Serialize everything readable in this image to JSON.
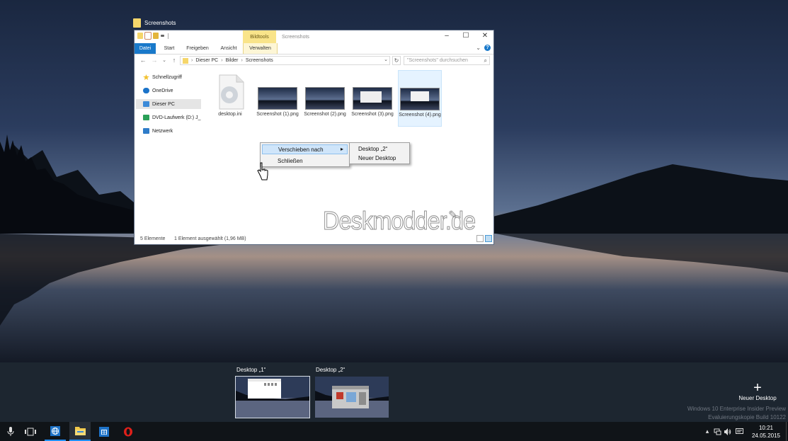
{
  "task_view": {
    "window_label": "Screenshots",
    "desktops": [
      {
        "label": "Desktop „1“",
        "active": true
      },
      {
        "label": "Desktop „2“",
        "active": false
      }
    ],
    "new_desktop_label": "Neuer Desktop",
    "os_watermark_line1": "Windows 10 Enterprise Insider Preview",
    "os_watermark_line2": "Evaluierungskopie Build 10122"
  },
  "explorer": {
    "title": "Screenshots",
    "bildtools_label": "Bildtools",
    "ribbon_tabs": [
      "Datei",
      "Start",
      "Freigeben",
      "Ansicht",
      "Verwalten"
    ],
    "address": {
      "path": [
        "Dieser PC",
        "Bilder",
        "Screenshots"
      ]
    },
    "search_placeholder": "\"Screenshots\" durchsuchen",
    "nav_items": [
      {
        "label": "Schnellzugriff",
        "icon": "star-icon",
        "color": "#f2c230"
      },
      {
        "label": "OneDrive",
        "icon": "cloud-icon",
        "color": "#1b73c9"
      },
      {
        "label": "Dieser PC",
        "icon": "computer-icon",
        "color": "#3b8ad8"
      },
      {
        "label": "DVD-Laufwerk (D:) J_",
        "icon": "dvd-icon",
        "color": "#2aa058"
      },
      {
        "label": "Netzwerk",
        "icon": "network-icon",
        "color": "#2f7cc9"
      }
    ],
    "files": [
      {
        "label": "desktop.ini",
        "type": "settings-file"
      },
      {
        "label": "Screenshot (1).png",
        "type": "image"
      },
      {
        "label": "Screenshot (2).png",
        "type": "image"
      },
      {
        "label": "Screenshot (3).png",
        "type": "image"
      },
      {
        "label": "Screenshot (4).png",
        "type": "image",
        "selected": true
      }
    ],
    "status_count": "5 Elemente",
    "status_selected": "1 Element ausgewählt (1,96 MB)",
    "watermark": "Deskmodder.de"
  },
  "context_menu": {
    "move_to": "Verschieben nach",
    "close": "Schließen",
    "submenu": [
      "Desktop „2“",
      "Neuer Desktop"
    ]
  },
  "taskbar": {
    "time": "10:21",
    "date": "24.05.2015",
    "accent_color": "#1e90ff"
  }
}
